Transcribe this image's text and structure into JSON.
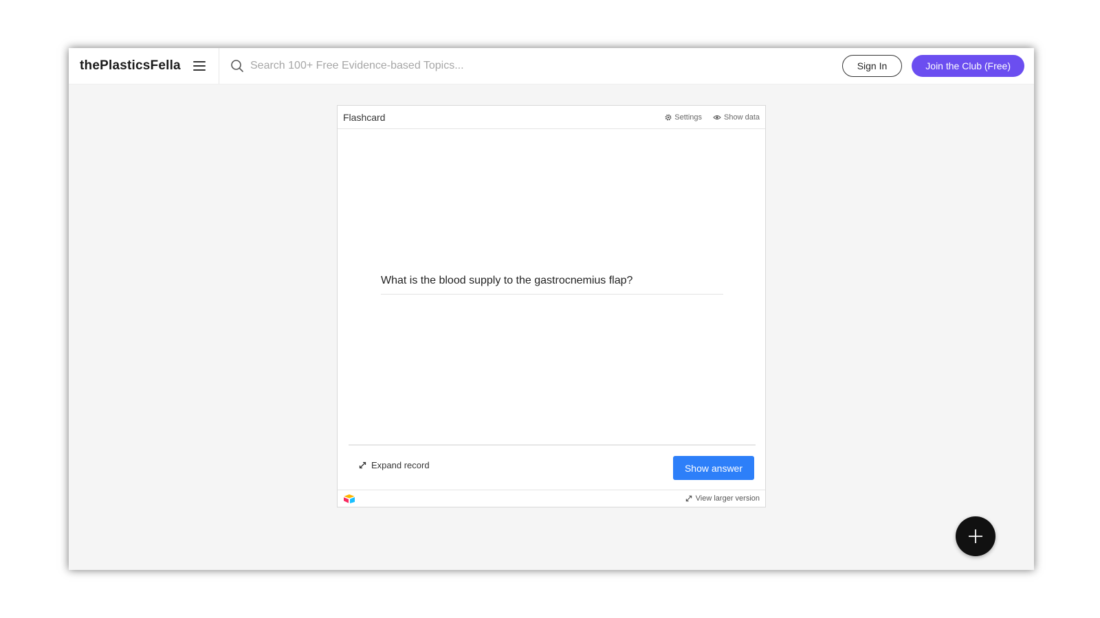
{
  "header": {
    "brand": "thePlasticsFella",
    "search_placeholder": "Search 100+ Free Evidence-based Topics...",
    "signin_label": "Sign In",
    "join_label": "Join the Club (Free)"
  },
  "flashcard": {
    "title": "Flashcard",
    "settings_label": "Settings",
    "show_data_label": "Show data",
    "question": "What is the blood supply to the gastrocnemius flap?",
    "expand_label": "Expand record",
    "show_answer_label": "Show answer",
    "view_larger_label": "View larger version"
  },
  "icons": {
    "menu": "hamburger-icon",
    "search": "search-icon",
    "settings": "gear-icon",
    "show_data": "eye-icon",
    "expand": "expand-arrows-icon",
    "logo": "airtable-logo-icon",
    "fab": "plus-icon"
  },
  "colors": {
    "join_button": "#6b4ef0",
    "show_answer_button": "#2d7ff9",
    "fab": "#111111"
  }
}
